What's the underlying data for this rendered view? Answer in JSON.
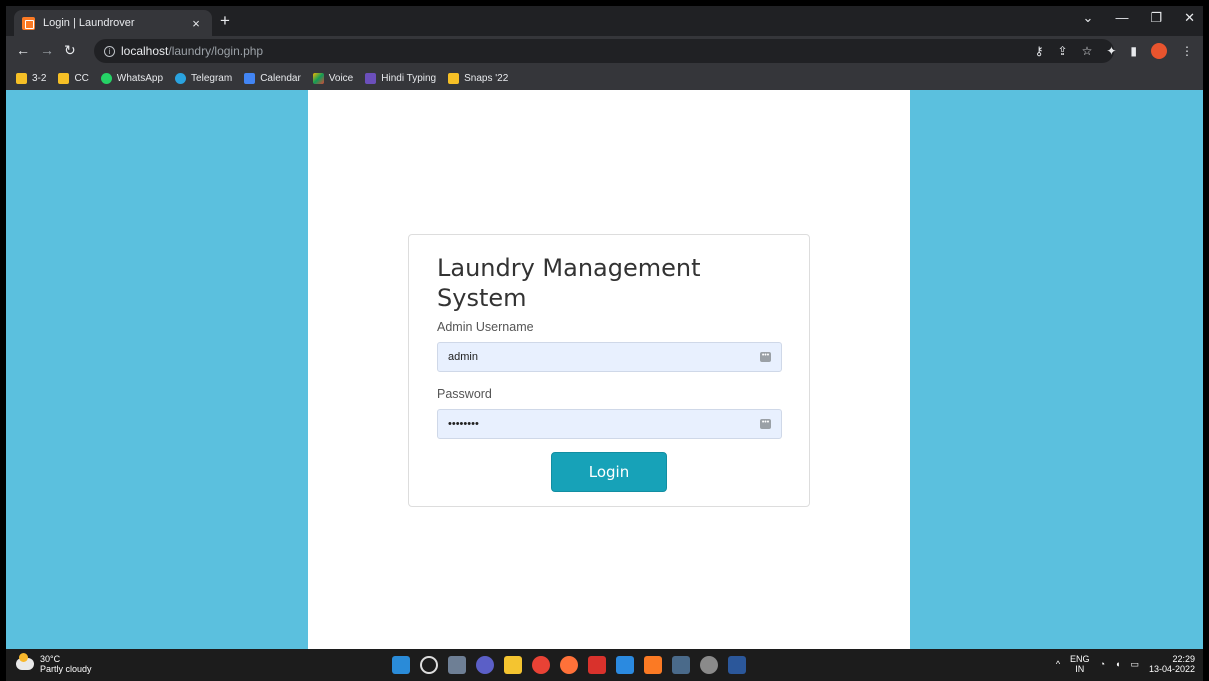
{
  "browser": {
    "tab_title": "Login | Laundrover",
    "tab_close": "×",
    "new_tab": "+",
    "url_host": "localhost",
    "url_path": "/laundry/login.php"
  },
  "bookmarks": [
    {
      "label": "3-2",
      "icon": "folder-icon"
    },
    {
      "label": "CC",
      "icon": "folder-icon"
    },
    {
      "label": "WhatsApp",
      "icon": "whatsapp-icon"
    },
    {
      "label": "Telegram",
      "icon": "telegram-icon"
    },
    {
      "label": "Calendar",
      "icon": "calendar-icon"
    },
    {
      "label": "Voice",
      "icon": "voice-icon"
    },
    {
      "label": "Hindi Typing",
      "icon": "hindi-typing-icon"
    },
    {
      "label": "Snaps '22",
      "icon": "folder-icon"
    }
  ],
  "login": {
    "title": "Laundry Management System",
    "username_label": "Admin Username",
    "username_value": "admin",
    "password_label": "Password",
    "password_value": "••••••••",
    "button_label": "Login"
  },
  "taskbar": {
    "temperature": "30°C",
    "weather": "Partly cloudy",
    "lang_top": "ENG",
    "lang_bottom": "IN",
    "time": "22:29",
    "date": "13-04-2022"
  },
  "colors": {
    "page_background": "#5bc0de",
    "button": "#17a2b8",
    "input_autofill": "#e8f0fe"
  }
}
